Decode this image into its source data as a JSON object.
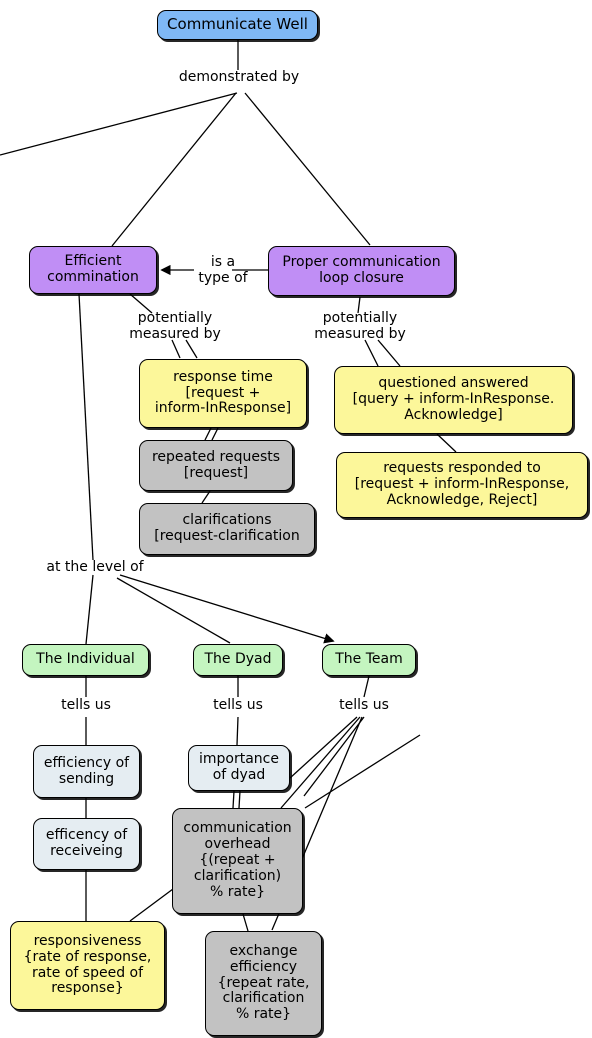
{
  "diagram": {
    "title": "Communicate Well concept map",
    "colors": {
      "root": "#7fb8f5",
      "concept": "#c08ef5",
      "measure": "#fcf79a",
      "metric": "#c2c2c2",
      "level": "#c4f5c0",
      "indicator": "#e5edf2",
      "line": "#000000"
    }
  },
  "nodes": {
    "root": {
      "label": "Communicate Well"
    },
    "efficient_communication": {
      "label": "Efficient\ncommination"
    },
    "loop_closure": {
      "label": "Proper communication\nloop closure"
    },
    "response_time": {
      "label": "response time\n[request +\ninform-InResponse]"
    },
    "repeated_requests": {
      "label": "repeated requests\n[request]"
    },
    "clarifications": {
      "label": "clarifications\n[request-clarification"
    },
    "questioned_answered": {
      "label": "questioned answered\n[query + inform-InResponse.\nAcknowledge]"
    },
    "requests_responded": {
      "label": "requests responded to\n[request + inform-InResponse,\nAcknowledge, Reject]"
    },
    "the_individual": {
      "label": "The Individual"
    },
    "the_dyad": {
      "label": "The Dyad"
    },
    "the_team": {
      "label": "The Team"
    },
    "efficiency_sending": {
      "label": "efficiency of\nsending"
    },
    "efficiency_receiving": {
      "label": "efficency of\nreceiveing"
    },
    "importance_dyad": {
      "label": "importance\nof dyad"
    },
    "communication_overhead": {
      "label": "communication\noverhead\n{(repeat +\nclarification)\n% rate}"
    },
    "responsiveness": {
      "label": "responsiveness\n{rate of response,\nrate of speed of\nresponse}"
    },
    "exchange_efficiency": {
      "label": "exchange\nefficiency\n{repeat rate,\nclarification\n% rate}"
    }
  },
  "link_labels": {
    "demonstrated_by": "demonstrated by",
    "is_a_type_of": "is a\ntype of",
    "potentially_measured_by_left": "potentially\nmeasured by",
    "potentially_measured_by_right": "potentially\nmeasured by",
    "at_the_level_of": "at the level of",
    "tells_us_individual": "tells us",
    "tells_us_dyad": "tells us",
    "tells_us_team": "tells us"
  }
}
